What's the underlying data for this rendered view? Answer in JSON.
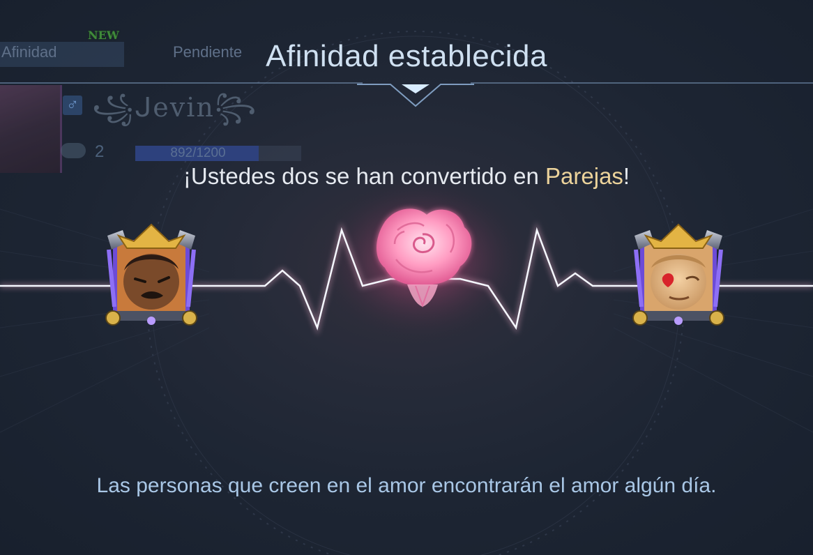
{
  "background_panel": {
    "tabs": [
      {
        "label": "Afinidad",
        "badge": "NEW"
      },
      {
        "label": "Pendiente"
      }
    ],
    "username": "꧁ᒍevin꧂",
    "count": "2",
    "progress": {
      "text": "892/1200",
      "value": 892,
      "max": 1200
    }
  },
  "dialog": {
    "title": "Afinidad establecida",
    "headline_prefix": "¡Ustedes dos se han convertido en ",
    "headline_highlight": "Parejas",
    "headline_suffix": "!",
    "quote": "Las personas que creen en el amor encontrarán el amor algún día."
  },
  "icons": {
    "rose": "rose-icon",
    "heartbeat": "heartbeat-line",
    "gender": "male-icon",
    "chat": "chat-icon"
  },
  "colors": {
    "title": "#cfe0f1",
    "highlight": "#ecd39b",
    "quote": "#a9c7e6",
    "rose_glow": "#ff7fae",
    "frame_gold": "#e3b444",
    "frame_purple": "#7a5cf0"
  }
}
